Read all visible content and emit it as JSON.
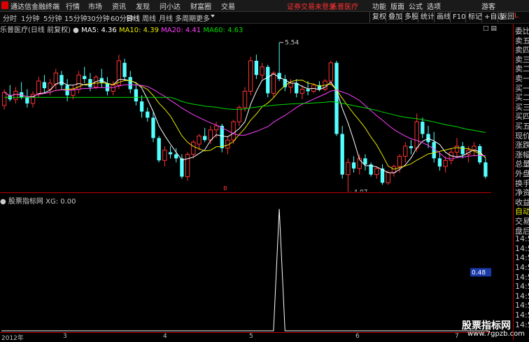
{
  "titlebar": {
    "app_name": "通达信金融终端",
    "menus": [
      "行情",
      "市场",
      "资讯",
      "发现",
      "问小达",
      "财富圈",
      "交易"
    ],
    "warning": "证券交易未登录",
    "stock_link": "乐普医疗",
    "right_menus": [
      "功能",
      "版面",
      "公式",
      "选项"
    ],
    "user": "游客"
  },
  "toolbar": {
    "timeframes": [
      "分时",
      "1分钟",
      "5分钟",
      "15分钟",
      "30分钟",
      "60分钟",
      "日线",
      "周线",
      "月线",
      "多周期",
      "更多"
    ],
    "active_timeframe": "日线",
    "buttons": [
      "复权",
      "叠加",
      "多股",
      "统计",
      "画线",
      "F10",
      "标记",
      "+自选",
      "返回"
    ]
  },
  "legend": {
    "stock": "乐普医疗(日线 前复权)",
    "ma5": "MA5: 4.36",
    "ma10": "MA10: 4.39",
    "ma20": "MA20: 4.41",
    "ma60": "MA60: 4.63"
  },
  "sub_legend": {
    "name": "股票指标网",
    "xg": "XG: 0.00"
  },
  "colors": {
    "up": "#ff3333",
    "down": "#54ffff",
    "ma5": "#ffffff",
    "ma10": "#e8e800",
    "ma20": "#ff40ff",
    "ma60": "#00dd00"
  },
  "chart_data": [
    {
      "type": "candlestick",
      "y_ticks": [
        "5.40",
        "5.20",
        "5.00",
        "4.80",
        "4.60",
        "4.40",
        "4.20"
      ],
      "ylim": [
        4.1,
        5.6
      ],
      "annotations": [
        {
          "label": "5.54",
          "value": 5.54
        },
        {
          "label": "4.07",
          "value": 4.07
        }
      ],
      "marker": "B",
      "ohlc": [
        [
          4.92,
          5.08,
          4.88,
          5.05
        ],
        [
          5.02,
          5.12,
          4.96,
          4.98
        ],
        [
          4.98,
          5.1,
          4.94,
          5.06
        ],
        [
          5.05,
          5.15,
          4.98,
          5.0
        ],
        [
          5.0,
          5.08,
          4.9,
          4.94
        ],
        [
          4.94,
          5.06,
          4.9,
          5.03
        ],
        [
          5.03,
          5.2,
          5.0,
          5.16
        ],
        [
          5.15,
          5.22,
          5.05,
          5.09
        ],
        [
          5.08,
          5.18,
          5.02,
          5.14
        ],
        [
          5.13,
          5.28,
          5.08,
          5.24
        ],
        [
          5.22,
          5.26,
          5.08,
          5.12
        ],
        [
          5.12,
          5.18,
          4.96,
          5.02
        ],
        [
          5.02,
          5.12,
          4.98,
          5.08
        ],
        [
          5.08,
          5.26,
          5.04,
          5.22
        ],
        [
          5.21,
          5.3,
          5.14,
          5.18
        ],
        [
          5.18,
          5.24,
          5.06,
          5.1
        ],
        [
          5.1,
          5.22,
          5.08,
          5.2
        ],
        [
          5.19,
          5.28,
          5.1,
          5.14
        ],
        [
          5.14,
          5.2,
          5.02,
          5.06
        ],
        [
          5.06,
          5.16,
          5.02,
          5.12
        ],
        [
          5.12,
          5.42,
          5.08,
          5.36
        ],
        [
          5.34,
          5.38,
          5.16,
          5.2
        ],
        [
          5.2,
          5.26,
          5.04,
          5.08
        ],
        [
          5.08,
          5.14,
          4.92,
          4.96
        ],
        [
          4.96,
          5.02,
          4.8,
          4.86
        ],
        [
          4.86,
          4.9,
          4.76,
          4.8
        ],
        [
          4.8,
          4.86,
          4.56,
          4.6
        ],
        [
          4.6,
          4.62,
          4.36,
          4.38
        ],
        [
          4.38,
          4.52,
          4.32,
          4.48
        ],
        [
          4.46,
          4.52,
          4.4,
          4.44
        ],
        [
          4.44,
          4.5,
          4.36,
          4.4
        ],
        [
          4.4,
          4.44,
          4.2,
          4.22
        ],
        [
          4.22,
          4.46,
          4.18,
          4.44
        ],
        [
          4.44,
          4.58,
          4.4,
          4.56
        ],
        [
          4.54,
          4.64,
          4.48,
          4.62
        ],
        [
          4.62,
          4.7,
          4.56,
          4.58
        ],
        [
          4.58,
          4.72,
          4.54,
          4.68
        ],
        [
          4.68,
          4.76,
          4.6,
          4.72
        ],
        [
          4.72,
          4.74,
          4.46,
          4.5
        ],
        [
          4.5,
          4.62,
          4.44,
          4.58
        ],
        [
          4.58,
          4.78,
          4.54,
          4.76
        ],
        [
          4.76,
          4.92,
          4.72,
          4.9
        ],
        [
          4.9,
          5.1,
          4.86,
          5.06
        ],
        [
          5.06,
          5.4,
          5.02,
          5.36
        ],
        [
          5.36,
          5.42,
          5.18,
          5.22
        ],
        [
          5.22,
          5.34,
          5.18,
          5.3
        ],
        [
          5.3,
          5.32,
          5.0,
          5.04
        ],
        [
          5.04,
          5.26,
          5.0,
          5.24
        ],
        [
          5.24,
          5.54,
          5.16,
          5.18
        ],
        [
          5.18,
          5.22,
          5.06,
          5.1
        ],
        [
          5.1,
          5.18,
          5.04,
          5.14
        ],
        [
          5.14,
          5.18,
          5.0,
          5.04
        ],
        [
          5.04,
          5.12,
          4.98,
          5.08
        ],
        [
          5.08,
          5.16,
          5.02,
          5.06
        ],
        [
          5.06,
          5.14,
          5.04,
          5.12
        ],
        [
          5.12,
          5.16,
          5.06,
          5.08
        ],
        [
          5.08,
          5.18,
          5.06,
          5.16
        ],
        [
          5.16,
          5.36,
          5.12,
          5.34
        ],
        [
          5.34,
          5.36,
          4.62,
          4.64
        ],
        [
          4.64,
          4.72,
          4.2,
          4.24
        ],
        [
          4.24,
          4.4,
          4.07,
          4.36
        ],
        [
          4.36,
          4.42,
          4.26,
          4.3
        ],
        [
          4.3,
          4.44,
          4.24,
          4.4
        ],
        [
          4.4,
          4.44,
          4.28,
          4.34
        ],
        [
          4.34,
          4.36,
          4.22,
          4.24
        ],
        [
          4.24,
          4.32,
          4.2,
          4.3
        ],
        [
          4.3,
          4.34,
          4.14,
          4.16
        ],
        [
          4.16,
          4.28,
          4.14,
          4.26
        ],
        [
          4.26,
          4.34,
          4.22,
          4.32
        ],
        [
          4.32,
          4.44,
          4.26,
          4.42
        ],
        [
          4.42,
          4.56,
          4.36,
          4.52
        ],
        [
          4.52,
          4.58,
          4.44,
          4.5
        ],
        [
          4.5,
          4.84,
          4.46,
          4.76
        ],
        [
          4.76,
          4.8,
          4.6,
          4.64
        ],
        [
          4.64,
          4.72,
          4.5,
          4.56
        ],
        [
          4.56,
          4.66,
          4.36,
          4.4
        ],
        [
          4.4,
          4.46,
          4.28,
          4.32
        ],
        [
          4.32,
          4.42,
          4.26,
          4.38
        ],
        [
          4.38,
          4.5,
          4.34,
          4.46
        ],
        [
          4.46,
          4.6,
          4.4,
          4.52
        ],
        [
          4.52,
          4.56,
          4.4,
          4.44
        ],
        [
          4.44,
          4.52,
          4.36,
          4.48
        ],
        [
          4.48,
          4.56,
          4.42,
          4.52
        ],
        [
          4.52,
          4.54,
          4.34,
          4.36
        ],
        [
          4.36,
          4.4,
          4.2,
          4.22
        ]
      ],
      "ma_series": [
        "MA5",
        "MA10",
        "MA20",
        "MA60"
      ]
    },
    {
      "type": "line",
      "name": "XG",
      "y_ticks": [
        "1.00",
        "0.80",
        "0.60",
        "0.40",
        "0.20"
      ],
      "ylim": [
        0,
        1.05
      ],
      "current_value": "0.48",
      "spike_index": 48
    }
  ],
  "x_axis_labels": [
    "2012年",
    "3",
    "4",
    "5",
    "6",
    "7"
  ],
  "right_panel": {
    "items": [
      {
        "text": "委比",
        "color": "default"
      },
      {
        "text": "卖五",
        "color": "default"
      },
      {
        "text": "卖四",
        "color": "default"
      },
      {
        "text": "卖三",
        "color": "default"
      },
      {
        "text": "卖二",
        "color": "default"
      },
      {
        "text": "卖一",
        "color": "default"
      },
      {
        "text": "买一",
        "color": "default"
      },
      {
        "text": "买二",
        "color": "default"
      },
      {
        "text": "买三",
        "color": "default"
      },
      {
        "text": "买四",
        "color": "default"
      },
      {
        "text": "买五",
        "color": "default"
      },
      {
        "text": "现价",
        "color": "default"
      },
      {
        "text": "涨跌",
        "color": "default"
      },
      {
        "text": "涨幅",
        "color": "default"
      },
      {
        "text": "总量",
        "color": "default"
      },
      {
        "text": "外盘",
        "color": "default"
      },
      {
        "text": "换手",
        "color": "default"
      },
      {
        "text": "净资",
        "color": "default"
      },
      {
        "text": "收益",
        "color": "default"
      },
      {
        "text": "自动",
        "color": "yellow"
      },
      {
        "text": "交易",
        "color": "default"
      },
      {
        "text": "盘后",
        "color": "default"
      },
      {
        "text": "14:5",
        "color": "default"
      },
      {
        "text": "14:5",
        "color": "default"
      },
      {
        "text": "14:5",
        "color": "default"
      },
      {
        "text": "14:5",
        "color": "default"
      },
      {
        "text": "14:5",
        "color": "default"
      },
      {
        "text": "14:5",
        "color": "default"
      },
      {
        "text": "14:5",
        "color": "default"
      },
      {
        "text": "14:5",
        "color": "default"
      },
      {
        "text": "14:5",
        "color": "default"
      },
      {
        "text": "14:5",
        "color": "default"
      }
    ],
    "header": "L"
  },
  "watermark": {
    "main": "股票指标网",
    "url": "www.7gpzb.com"
  }
}
